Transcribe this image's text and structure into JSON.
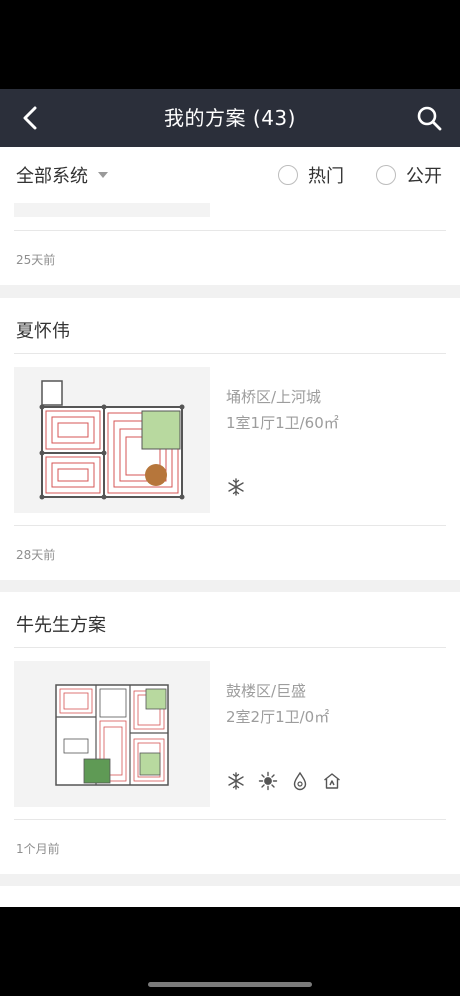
{
  "navbar": {
    "title": "我的方案 (43)",
    "back_icon": "chevron-left-icon",
    "search_icon": "search-icon"
  },
  "filter": {
    "system_label": "全部系统",
    "hot_label": "热门",
    "public_label": "公开"
  },
  "plans": [
    {
      "time": "25天前"
    },
    {
      "title": "夏怀伟",
      "location": "埇桥区/上河城",
      "layout": "1室1厅1卫/60㎡",
      "systems": [
        "snowflake-icon"
      ],
      "time": "28天前"
    },
    {
      "title": "牛先生方案",
      "location": "鼓楼区/巨盛",
      "layout": "2室2厅1卫/0㎡",
      "systems": [
        "snowflake-icon",
        "sun-icon",
        "water-drop-icon",
        "house-icon"
      ],
      "time": "1个月前"
    }
  ],
  "colors": {
    "navbar_bg": "#2b2f3a",
    "page_bg": "#f1f1f1",
    "text_primary": "#333333",
    "text_secondary": "#9d9d9d"
  }
}
